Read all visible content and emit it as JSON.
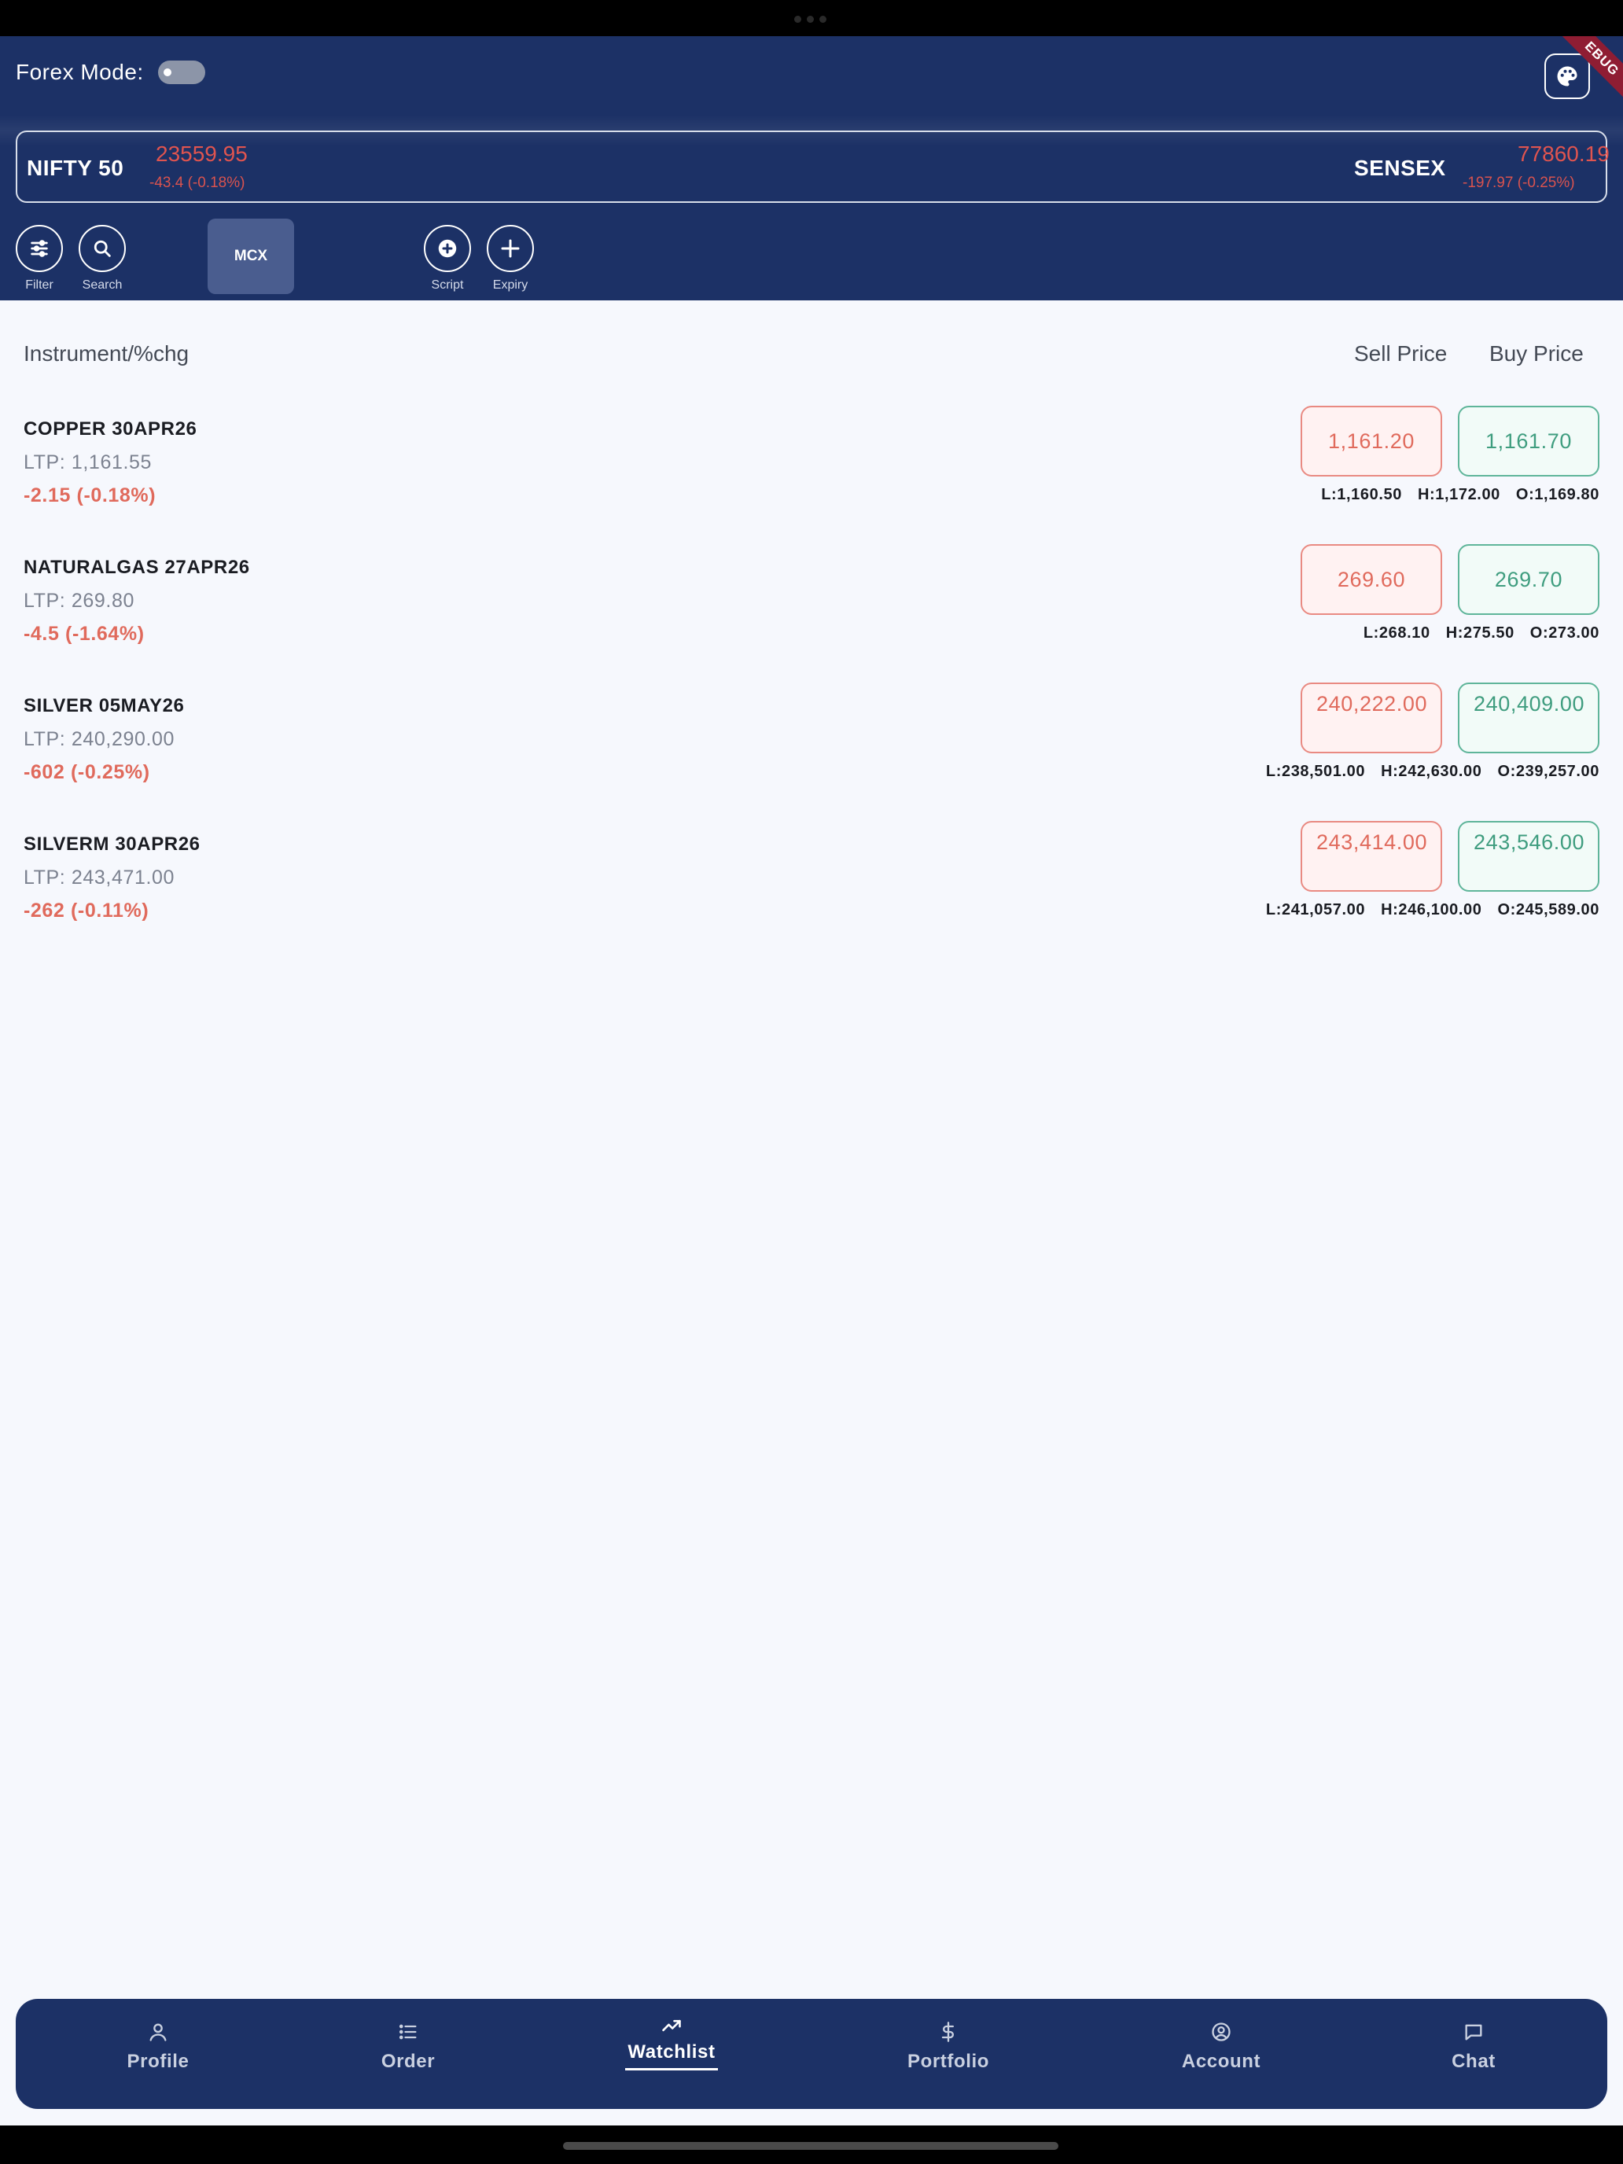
{
  "header": {
    "forex_label": "Forex Mode:",
    "debug_banner": "EBUG",
    "indices": [
      {
        "name": "NIFTY 50",
        "price": "23559.95",
        "change": "-43.4 (-0.18%)"
      },
      {
        "name": "SENSEX",
        "price": "77860.19",
        "change": "-197.97 (-0.25%)"
      }
    ],
    "tools": {
      "filter": "Filter",
      "search": "Search",
      "exchange": "MCX",
      "script": "Script",
      "expiry": "Expiry"
    }
  },
  "columns": {
    "instrument": "Instrument/%chg",
    "sell": "Sell Price",
    "buy": "Buy Price"
  },
  "rows": [
    {
      "name": "COPPER 30APR26",
      "ltp": "LTP: 1,161.55",
      "change": "-2.15 (-0.18%)",
      "sell": "1,161.20",
      "buy": "1,161.70",
      "low": "L:1,160.50",
      "high": "H:1,172.00",
      "open": "O:1,169.80"
    },
    {
      "name": "NATURALGAS 27APR26",
      "ltp": "LTP: 269.80",
      "change": "-4.5 (-1.64%)",
      "sell": "269.60",
      "buy": "269.70",
      "low": "L:268.10",
      "high": "H:275.50",
      "open": "O:273.00"
    },
    {
      "name": "SILVER 05MAY26",
      "ltp": "LTP: 240,290.00",
      "change": "-602 (-0.25%)",
      "sell": "240,222.00",
      "buy": "240,409.00",
      "low": "L:238,501.00",
      "high": "H:242,630.00",
      "open": "O:239,257.00"
    },
    {
      "name": "SILVERM 30APR26",
      "ltp": "LTP: 243,471.00",
      "change": "-262 (-0.11%)",
      "sell": "243,414.00",
      "buy": "243,546.00",
      "low": "L:241,057.00",
      "high": "H:246,100.00",
      "open": "O:245,589.00"
    }
  ],
  "nav": {
    "profile": "Profile",
    "order": "Order",
    "watchlist": "Watchlist",
    "portfolio": "Portfolio",
    "account": "Account",
    "chat": "Chat",
    "active": "Watchlist"
  },
  "colors": {
    "header_bg": "#1c3166",
    "sell": "#e06a5c",
    "buy": "#3f9d7f"
  }
}
